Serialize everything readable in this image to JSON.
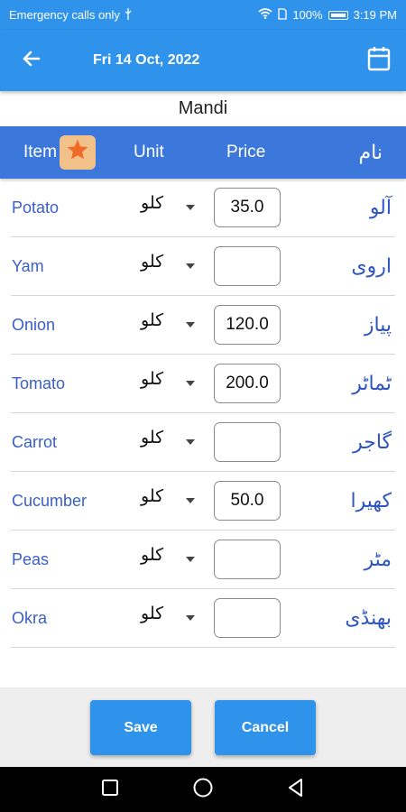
{
  "status_bar": {
    "carrier": "Emergency calls only",
    "battery": "100%",
    "time": "3:19 PM"
  },
  "app_bar": {
    "title": "Fri 14 Oct, 2022",
    "back_icon": "arrow-left-icon",
    "calendar_icon": "calendar-icon"
  },
  "market_name": "Mandi",
  "table_header": {
    "item": "Item",
    "unit": "Unit",
    "price": "Price",
    "urdu": "نام"
  },
  "rows": [
    {
      "item": "Potato",
      "unit": "کلو",
      "price": "35.0",
      "urdu": "آلو"
    },
    {
      "item": "Yam",
      "unit": "کلو",
      "price": "",
      "urdu": "اروی"
    },
    {
      "item": "Onion",
      "unit": "کلو",
      "price": "120.0",
      "urdu": "پیاز"
    },
    {
      "item": "Tomato",
      "unit": "کلو",
      "price": "200.0",
      "urdu": "ٹماٹر"
    },
    {
      "item": "Carrot",
      "unit": "کلو",
      "price": "",
      "urdu": "گاجر"
    },
    {
      "item": "Cucumber",
      "unit": "کلو",
      "price": "50.0",
      "urdu": "کھیرا"
    },
    {
      "item": "Peas",
      "unit": "کلو",
      "price": "",
      "urdu": "مٹر"
    },
    {
      "item": "Okra",
      "unit": "کلو",
      "price": "",
      "urdu": "بھنڈی"
    }
  ],
  "buttons": {
    "save": "Save",
    "cancel": "Cancel"
  },
  "colors": {
    "primary": "#2f93ec",
    "header": "#3c78dc",
    "star_bg": "#f2c089",
    "star": "#f06a2a"
  }
}
